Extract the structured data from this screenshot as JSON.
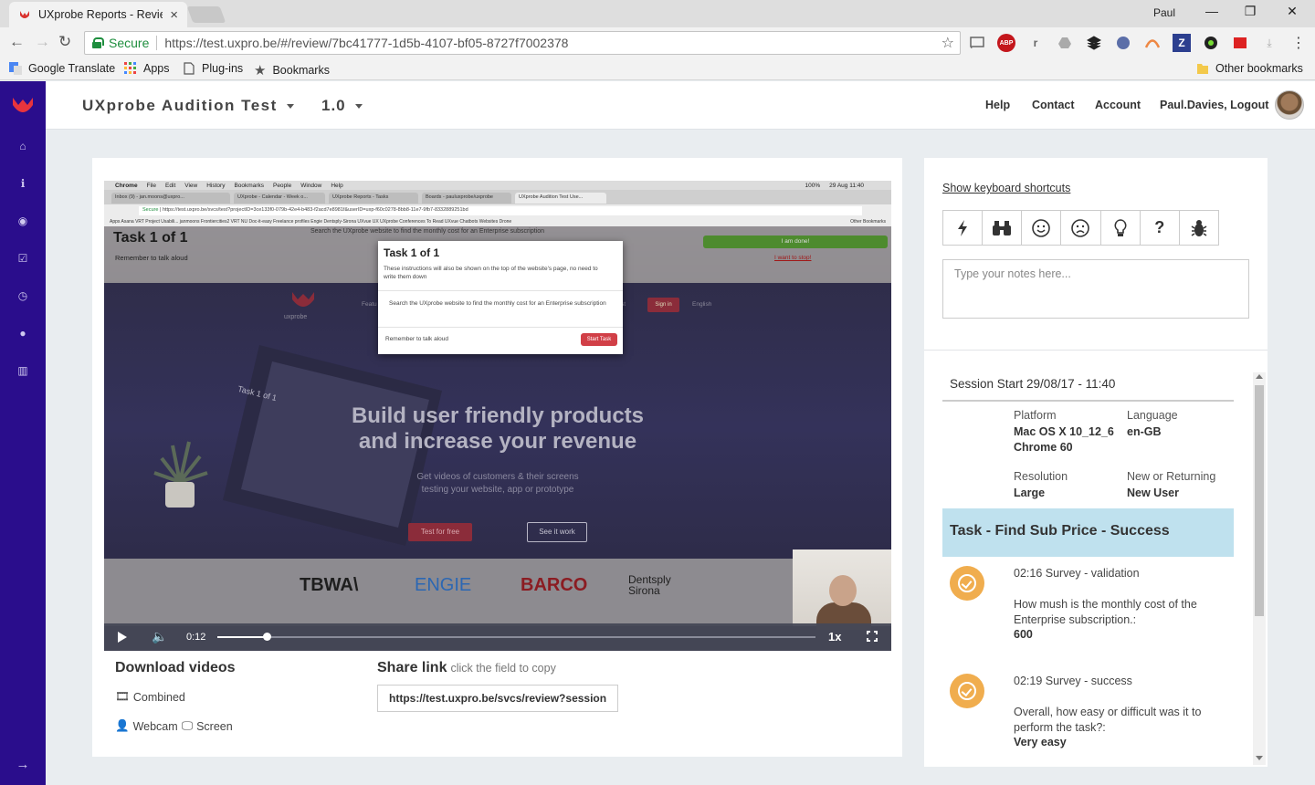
{
  "browser": {
    "tab_title": "UXprobe Reports - Review",
    "tab_close": "×",
    "window_user": "Paul",
    "window_controls": [
      "—",
      "❐",
      "✕"
    ],
    "nav": {
      "back": "←",
      "forward": "→",
      "reload": "↻"
    },
    "secure_label": "Secure",
    "url": "https://test.uxpro.be/#/review/7bc41777-1d5b-4107-bf05-8727f7002378",
    "bookmark_star": "☆",
    "extensions": [
      "cast-icon",
      "abp-icon",
      "r-icon",
      "drive-icon",
      "layers-icon",
      "w-icon",
      "arc-icon",
      "z-icon",
      "color-icon",
      "recorder-icon",
      "pocket-icon"
    ],
    "extension_labels": [
      "ABP",
      "r",
      "Z"
    ],
    "menu": "⋮",
    "bookmarks": [
      {
        "label": "Google Translate",
        "icon": "google-translate-icon"
      },
      {
        "label": "Apps",
        "icon": "apps-grid-icon"
      },
      {
        "label": "Plug-ins",
        "icon": "page-icon"
      },
      {
        "label": "Bookmarks",
        "icon": "star-icon"
      }
    ],
    "other_bookmarks": "Other bookmarks"
  },
  "app": {
    "brand_color": "#2a0d8c",
    "accent": "#f0ad4e",
    "project_name": "UXprobe Audition Test",
    "version": "1.0",
    "nav": [
      "Help",
      "Contact",
      "Account",
      "Paul.Davies, Logout"
    ],
    "sidebar_icons": [
      "home-icon",
      "info-icon",
      "dashboard-icon",
      "checklist-icon",
      "clock-icon",
      "comment-icon",
      "bar-chart-icon"
    ],
    "sidebar_expand": "→"
  },
  "video": {
    "mac_menu": [
      "Chrome",
      "File",
      "Edit",
      "View",
      "History",
      "Bookmarks",
      "People",
      "Window",
      "Help"
    ],
    "mac_clock": "29 Aug 11:40",
    "mac_battery": "100%",
    "inner_tabs": [
      "Inbox (9) - jan.moons@uxpro...",
      "UXprobe - Calendar - Week o...",
      "UXprobe Reports - Tasks",
      "Boards - pauluxprobe/uxprobe",
      "UXprobe Audition Test Use..."
    ],
    "inner_secure": "Secure",
    "inner_url": "https://test.uxpro.be/svcs/test?projectID=3ce133f0-079b-42e4-b483-f2acd7e8981f&userID=uxp-f60c0278-8bb8-11e7-9fb7-8332889251bd",
    "inner_bookmarks": "Apps  Asana  VRT Project Usabili...  janmoons  Frontiercities2  VRT NU  Doc-it-easy  Freelance profiles  Engie  Dentsply-Sirona  UXvue  UX  UXprobe  Conferences  To Read  UXvue  Chatbots  Websites  Drone",
    "inner_other_bookmarks": "Other Bookmarks",
    "task_title": "Task 1 of 1",
    "talk_aloud": "Remember to talk aloud",
    "search_banner": "Search the UXprobe website to find the monthly cost for an Enterprise subscription",
    "done_button": "I am done!",
    "stop_link": "I want to stop!",
    "modal": {
      "title": "Task 1 of 1",
      "desc": "These instructions will also be shown on the top of the website's page, no need to write them down",
      "task": "Search the UXprobe website to find the monthly cost for an Enterprise subscription",
      "talk": "Remember to talk aloud",
      "start": "Start Task"
    },
    "site_logo": "uxprobe",
    "site_nav": [
      "Featu",
      "st",
      "English"
    ],
    "site_signin": "Sign in",
    "hero_title_1": "Build user friendly products",
    "hero_title_2": "and increase your revenue",
    "hero_sub_1": "Get videos of customers & their screens",
    "hero_sub_2": "testing your website, app or prototype",
    "cta_primary": "Test for free",
    "cta_secondary": "See it work",
    "customer_logos": [
      "TBWA\\",
      "ENGIE",
      "BARCO",
      "Dentsply Sirona"
    ],
    "laptop_screen_text": "Task 1 of 1",
    "time": "0:12",
    "progress": 0.082,
    "speed": "1x"
  },
  "downloads": {
    "title": "Download videos",
    "combined": "Combined",
    "webcam": "Webcam",
    "screen": "Screen"
  },
  "share": {
    "title": "Share link",
    "hint": "click the field to copy",
    "value": "https://test.uxpro.be/svcs/review?sessionID"
  },
  "review": {
    "shortcuts_link": "Show keyboard shortcuts",
    "event_buttons": [
      {
        "icon": "lightning-icon",
        "glyph": "ϟ"
      },
      {
        "icon": "binoculars-icon",
        "glyph": "⚭"
      },
      {
        "icon": "smile-icon",
        "glyph": "☺"
      },
      {
        "icon": "frown-icon",
        "glyph": "☹"
      },
      {
        "icon": "lightbulb-icon",
        "glyph": "💡"
      },
      {
        "icon": "question-icon",
        "glyph": "?"
      },
      {
        "icon": "bug-icon",
        "glyph": "✲"
      }
    ],
    "notes_placeholder": "Type your notes here...",
    "session_start": "Session Start 29/08/17 - 11:40",
    "meta": {
      "platform_label": "Platform",
      "platform_value_1": "Mac OS X 10_12_6",
      "platform_value_2": "Chrome 60",
      "language_label": "Language",
      "language_value": "en-GB",
      "resolution_label": "Resolution",
      "resolution_value": "Large",
      "returning_label": "New or Returning",
      "returning_value": "New User"
    },
    "task_header": "Task - Find Sub Price - Success",
    "events": [
      {
        "time": "02:16 Survey - validation",
        "question": "How mush is the monthly cost of the Enterprise subscription.:",
        "answer": "600"
      },
      {
        "time": "02:19 Survey - success",
        "question": "Overall, how easy or difficult was it to perform the task?:",
        "answer": "Very easy"
      }
    ]
  }
}
